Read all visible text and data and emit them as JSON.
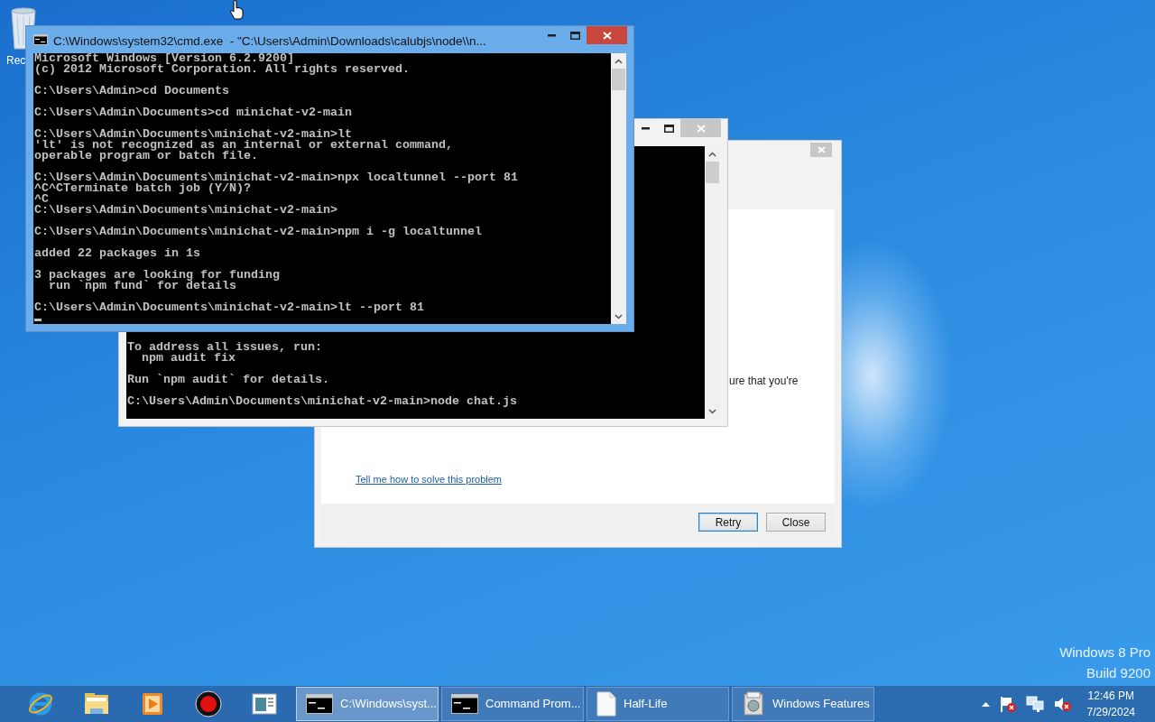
{
  "desktop": {
    "icons": [
      {
        "label": "Rec"
      }
    ],
    "edition": "Windows 8 Pro",
    "build": "Build 9200"
  },
  "windows": [
    {
      "kind": "console",
      "active": true,
      "cursor": true,
      "title": "C:\\Windows\\system32\\cmd.exe  - \"C:\\Users\\Admin\\Downloads\\calubjs\\node\\\\n...",
      "paragraphs": [
        [
          "Microsoft Windows [Version 6.2.9200]",
          "(c) 2012 Microsoft Corporation. All rights reserved."
        ],
        [
          "C:\\Users\\Admin>cd Documents"
        ],
        [
          "C:\\Users\\Admin\\Documents>cd minichat-v2-main"
        ],
        [
          "C:\\Users\\Admin\\Documents\\minichat-v2-main>lt",
          "'lt' is not recognized as an internal or external command,",
          "operable program or batch file."
        ],
        [
          "C:\\Users\\Admin\\Documents\\minichat-v2-main>npx localtunnel --port 81",
          "^C^CTerminate batch job (Y/N)?",
          "^C",
          "C:\\Users\\Admin\\Documents\\minichat-v2-main>"
        ],
        [
          "C:\\Users\\Admin\\Documents\\minichat-v2-main>npm i -g localtunnel"
        ],
        [
          "added 22 packages in 1s"
        ],
        [
          "3 packages are looking for funding",
          "  run `npm fund` for details"
        ],
        [
          "C:\\Users\\Admin\\Documents\\minichat-v2-main>lt --port 81"
        ]
      ]
    },
    {
      "kind": "console",
      "active": false,
      "cursor": false,
      "paragraphs": [
        [
          "To address all issues, run:",
          "  npm audit fix"
        ],
        [
          "Run `npm audit` for details."
        ],
        [
          "C:\\Users\\Admin\\Documents\\minichat-v2-main>node chat.js"
        ]
      ]
    },
    {
      "kind": "dialog",
      "active": false,
      "fragment": "ure that you're",
      "link": "Tell me how to solve this problem",
      "buttons": [
        {
          "label": "Retry",
          "default": true
        },
        {
          "label": "Close",
          "default": false
        }
      ]
    }
  ],
  "taskbar": {
    "tasks": [
      {
        "label": "C:\\Windows\\syst...",
        "kind": "console",
        "selected": true
      },
      {
        "label": "Command Prom...",
        "kind": "console",
        "selected": false
      },
      {
        "label": "Half-Life",
        "kind": "document",
        "selected": false
      },
      {
        "label": "Windows Features",
        "kind": "features",
        "selected": false
      }
    ],
    "clock": {
      "time": "12:46 PM",
      "date": "7/29/2024"
    }
  }
}
